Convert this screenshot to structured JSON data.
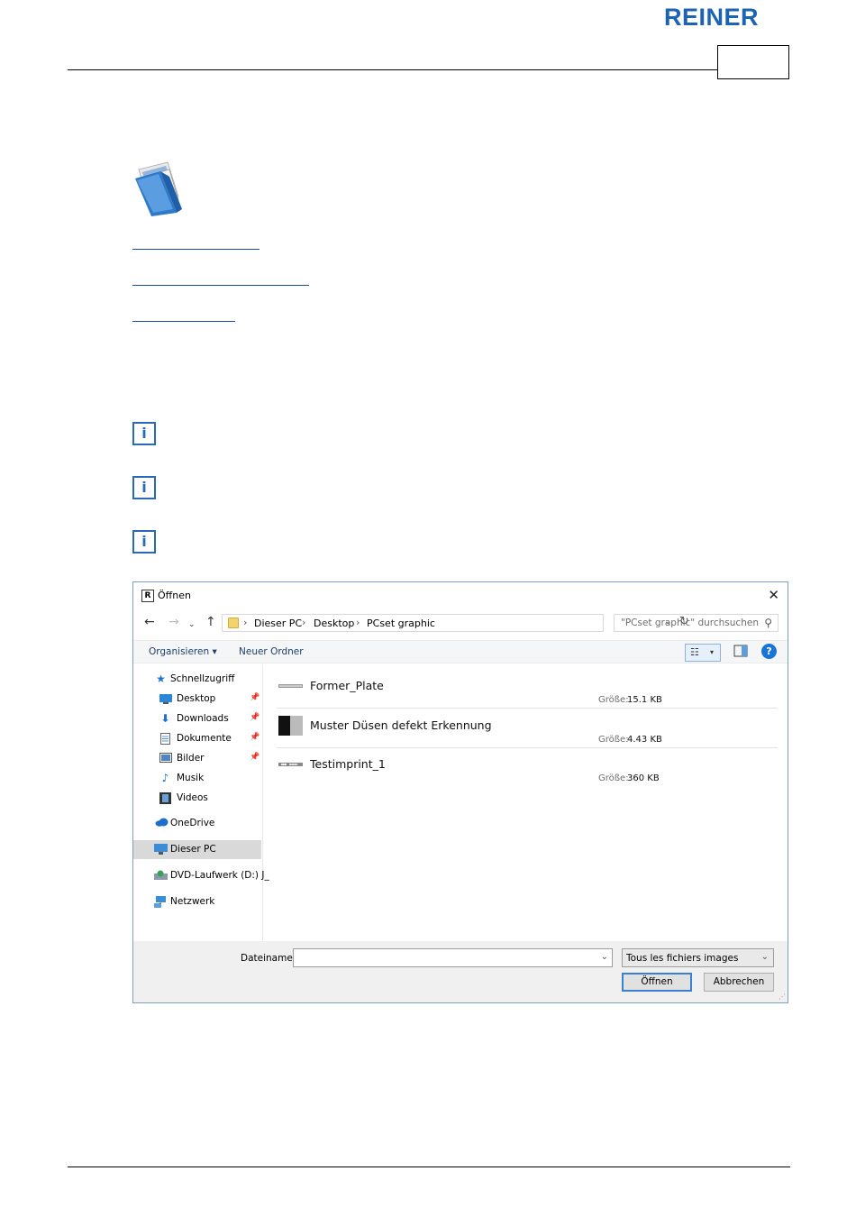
{
  "header": {
    "brand": "REINER"
  },
  "dialog": {
    "title": "Öffnen",
    "app_icon": "R",
    "close_icon": "close-icon",
    "nav": {
      "back_icon": "arrow-left-icon",
      "forward_icon": "arrow-right-icon",
      "recent_icon": "chevron-down-icon",
      "up_icon": "arrow-up-icon"
    },
    "breadcrumbs": [
      "Dieser PC",
      "Desktop",
      "PCset graphic"
    ],
    "search_placeholder": "\"PCset graphic\" durchsuchen",
    "toolbar": {
      "organize": "Organisieren",
      "new_folder": "Neuer Ordner",
      "help": "?"
    },
    "sidebar": {
      "quick_access": "Schnellzugriff",
      "quick_items": [
        {
          "label": "Desktop",
          "icon": "desktop-icon"
        },
        {
          "label": "Downloads",
          "icon": "download-arrow-icon"
        },
        {
          "label": "Dokumente",
          "icon": "document-icon"
        },
        {
          "label": "Bilder",
          "icon": "pictures-icon"
        },
        {
          "label": "Musik",
          "icon": "music-note-icon"
        },
        {
          "label": "Videos",
          "icon": "film-icon"
        }
      ],
      "onedrive": "OneDrive",
      "this_pc": "Dieser PC",
      "dvd": "DVD-Laufwerk (D:) J_",
      "network": "Netzwerk"
    },
    "files": [
      {
        "name": "Former_Plate",
        "size_label": "Größe:",
        "size": "15.1 KB"
      },
      {
        "name": "Muster Düsen defekt Erkennung",
        "size_label": "Größe:",
        "size": "4.43 KB"
      },
      {
        "name": "Testimprint_1",
        "size_label": "Größe:",
        "size": "360 KB"
      }
    ],
    "footer": {
      "filename_label": "Dateiname:",
      "filename_value": "",
      "filetype": "Tous les fichiers images",
      "open": "Öffnen",
      "cancel": "Abbrechen"
    },
    "colors": {
      "accent": "#1a74d8",
      "selected_bg": "#d9d9d9"
    }
  }
}
